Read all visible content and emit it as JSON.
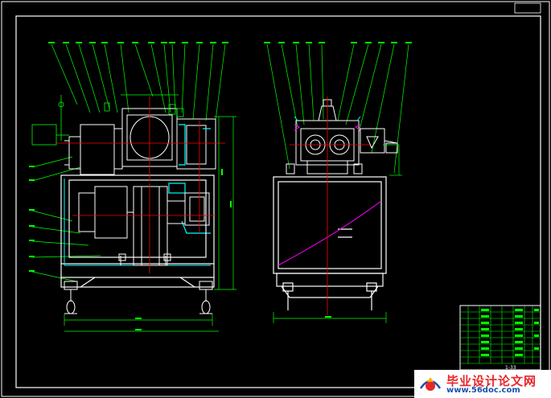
{
  "drawing": {
    "background": "#000000",
    "line_colors": {
      "frame": "#ffffff",
      "outline": "#ffffff",
      "leader": "#00ff00",
      "dimension": "#00ff00",
      "centerline": "#ff0000",
      "hidden": "#ff00ff",
      "accent": "#00ffff",
      "title_block": "#00ff00"
    },
    "views": [
      "front-sectional-view",
      "side-view"
    ],
    "title_block_label": "1-33"
  },
  "watermark": {
    "title": "毕业设计论文网",
    "url": "www.56doc.com",
    "title_color": "#e8262a",
    "url_color": "#1a50b0"
  }
}
